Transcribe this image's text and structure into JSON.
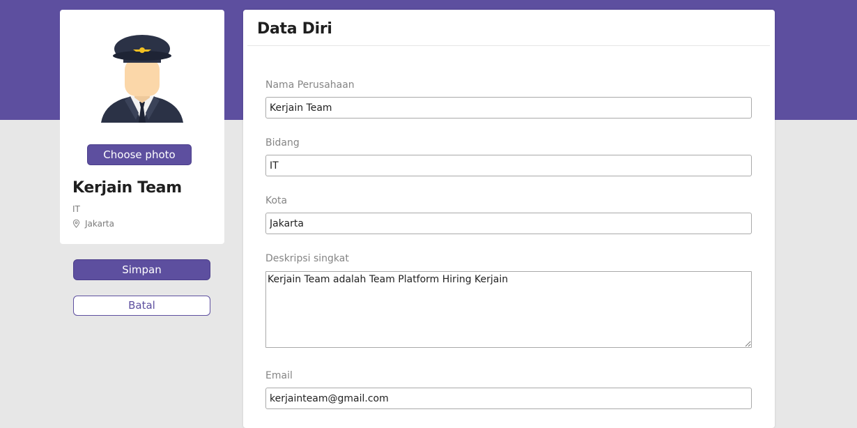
{
  "profile": {
    "choose_photo_label": "Choose photo",
    "name": "Kerjain Team",
    "field": "IT",
    "city": "Jakarta"
  },
  "actions": {
    "save_label": "Simpan",
    "cancel_label": "Batal"
  },
  "form": {
    "title": "Data Diri",
    "company_label": "Nama Perusahaan",
    "company_value": "Kerjain Team",
    "field_label": "Bidang",
    "field_value": "IT",
    "city_label": "Kota",
    "city_value": "Jakarta",
    "description_label": "Deskripsi singkat",
    "description_value": "Kerjain Team adalah Team Platform Hiring Kerjain",
    "email_label": "Email",
    "email_value": "kerjainteam@gmail.com"
  },
  "icons": {
    "avatar": "pilot-avatar-icon",
    "location": "location-pin-icon"
  },
  "colors": {
    "brand": "#5d4f9f",
    "background": "#e7e7e7",
    "card": "#ffffff"
  }
}
